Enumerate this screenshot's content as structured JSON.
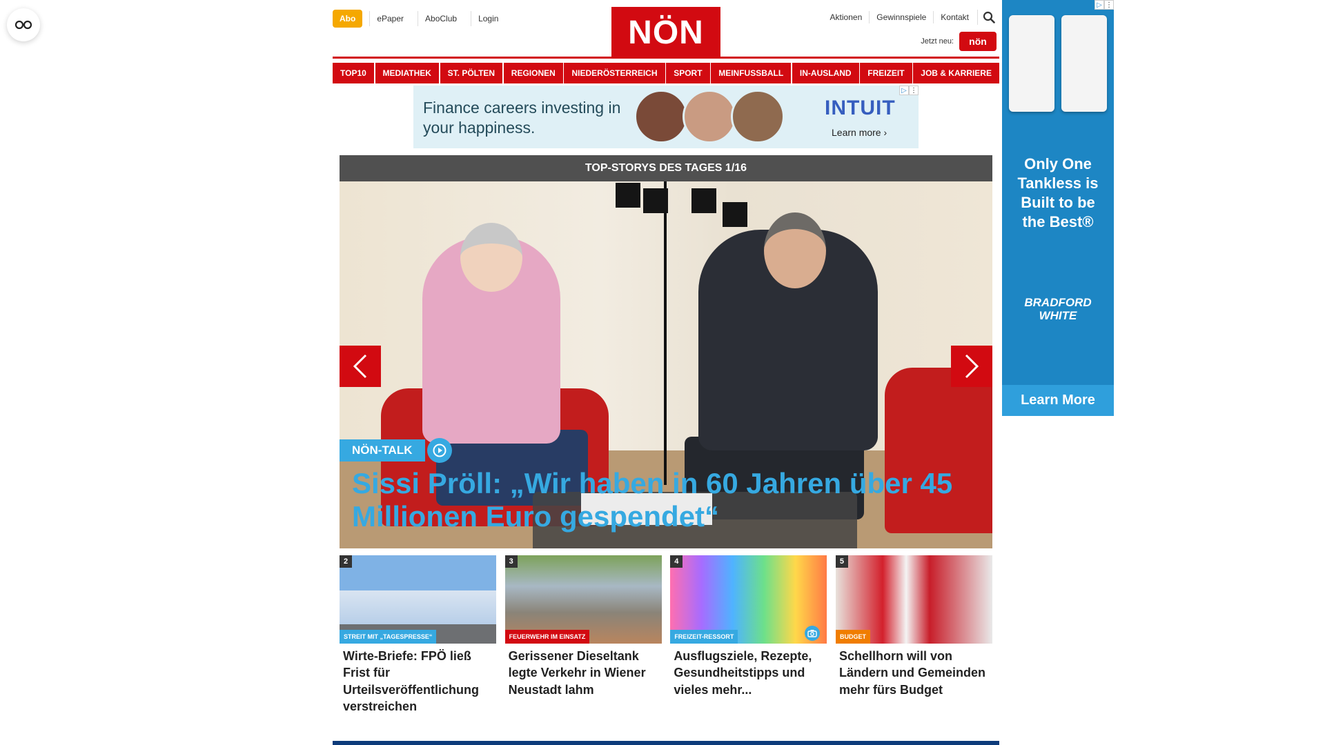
{
  "header": {
    "abo_label": "Abo",
    "links_left": [
      "ePaper",
      "AboClub",
      "Login"
    ],
    "logo_text": "NÖN",
    "links_right": [
      "Aktionen",
      "Gewinnspiele",
      "Kontakt"
    ],
    "jetzt_label": "Jetzt neu:",
    "mini_logo_text": "nön"
  },
  "nav": {
    "items": [
      "TOP10",
      "MEDIATHEK",
      "ST. PÖLTEN",
      "REGIONEN",
      "NIEDERÖSTERREICH",
      "SPORT",
      "MEINFUSSBALL",
      "IN-AUSLAND",
      "FREIZEIT",
      "JOB & KARRIERE"
    ]
  },
  "ad_top": {
    "headline": "Finance careers investing in your happiness.",
    "brand": "INTUIT",
    "cta": "Learn more ›"
  },
  "hero": {
    "heading": "TOP-STORYS DES TAGES 1/16",
    "tag": "NÖN-TALK",
    "title": "Sissi Pröll: „Wir haben in 60 Jahren über 45 Millionen Euro gespendet“"
  },
  "articles": [
    {
      "num": "2",
      "tag": "STREIT MIT „TAGESPRESSE“",
      "tag_color": "#36a9e1",
      "title": "Wirte-Briefe: FPÖ ließ Frist für Urteilsveröffentlichung verstreichen"
    },
    {
      "num": "3",
      "tag": "FEUERWEHR IM EINSATZ",
      "tag_color": "#d20a11",
      "title": "Gerissener Dieseltank legte Verkehr in Wiener Neustadt lahm"
    },
    {
      "num": "4",
      "tag": "FREIZEIT-RESSORT",
      "tag_color": "#36a9e1",
      "title": "Ausflugsziele, Rezepte, Gesundheitstipps und vieles mehr..."
    },
    {
      "num": "5",
      "tag": "BUDGET",
      "tag_color": "#f07d00",
      "title": "Schellhorn will von Ländern und Gemeinden mehr fürs Budget"
    }
  ],
  "ad_side": {
    "headline": "Only One Tankless is Built to be the Best®",
    "brand": "BRADFORD WHITE",
    "cta": "Learn More"
  },
  "colors": {
    "brand_red": "#d20a11",
    "accent_blue": "#36a9e1",
    "abo_orange": "#f5a800"
  }
}
